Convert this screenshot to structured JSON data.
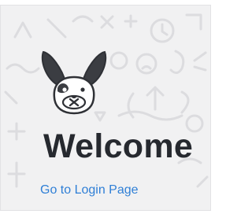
{
  "mascot": {
    "icon": "bunny-mascot-icon",
    "body_color": "#ffffff",
    "ear_color": "#3b3d42",
    "outline_color": "#2f3136"
  },
  "welcome": {
    "title": "Welcome"
  },
  "login": {
    "link_label": "Go to Login Page",
    "link_color": "#2f7fd6"
  }
}
